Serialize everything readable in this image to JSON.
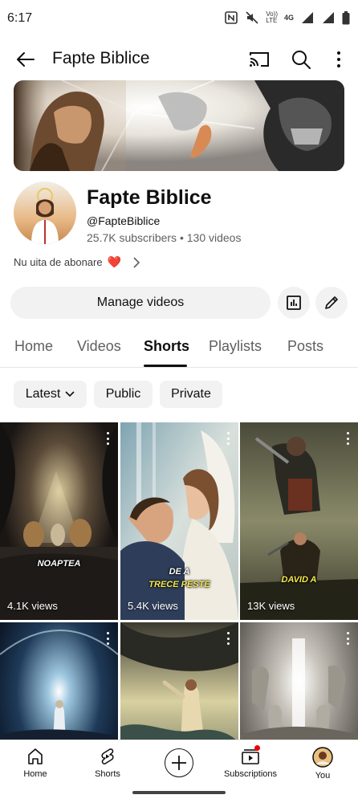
{
  "status_bar": {
    "time": "6:17",
    "network_line1": "Vo))",
    "network_line2": "LTE",
    "network_type": "4G",
    "icons": [
      "nfc-icon",
      "mute-icon",
      "signal-icon",
      "signal-icon",
      "battery-icon"
    ]
  },
  "top_bar": {
    "title": "Fapte Biblice",
    "icons": [
      "back-arrow-icon",
      "cast-icon",
      "search-icon",
      "more-vert-icon"
    ]
  },
  "channel": {
    "name": "Fapte Biblice",
    "handle": "@FapteBiblice",
    "subscribers": "25.7K subscribers",
    "separator": " • ",
    "videos": "130 videos",
    "description": "Nu uita de abonare",
    "description_emoji": "❤️"
  },
  "actions": {
    "manage_videos": "Manage videos",
    "icons": [
      "analytics-icon",
      "edit-pencil-icon"
    ]
  },
  "tabs": {
    "items": [
      {
        "label": "Home",
        "active": false
      },
      {
        "label": "Videos",
        "active": false
      },
      {
        "label": "Shorts",
        "active": true
      },
      {
        "label": "Playlists",
        "active": false
      },
      {
        "label": "Posts",
        "active": false
      }
    ]
  },
  "filters": {
    "latest": "Latest",
    "public": "Public",
    "private": "Private"
  },
  "shorts": [
    {
      "views": "4.1K views",
      "caption": "NOAPTEA",
      "caption_color": "white"
    },
    {
      "views": "5.4K views",
      "caption_line1": "DE A",
      "caption_line2": "TRECE PESTE",
      "caption_color": "yellow"
    },
    {
      "views": "13K views",
      "caption": "DAVID A",
      "caption_color": "yellow"
    },
    {
      "views": ""
    },
    {
      "views": ""
    },
    {
      "views": ""
    }
  ],
  "bottom_nav": {
    "home": "Home",
    "shorts": "Shorts",
    "subscriptions": "Subscriptions",
    "you": "You"
  },
  "colors": {
    "accent": "#0f0f0f",
    "chip_bg": "#f2f2f2",
    "notification_dot": "#ee0000",
    "heart": "#e53935",
    "caption_yellow": "#f5e84a"
  }
}
